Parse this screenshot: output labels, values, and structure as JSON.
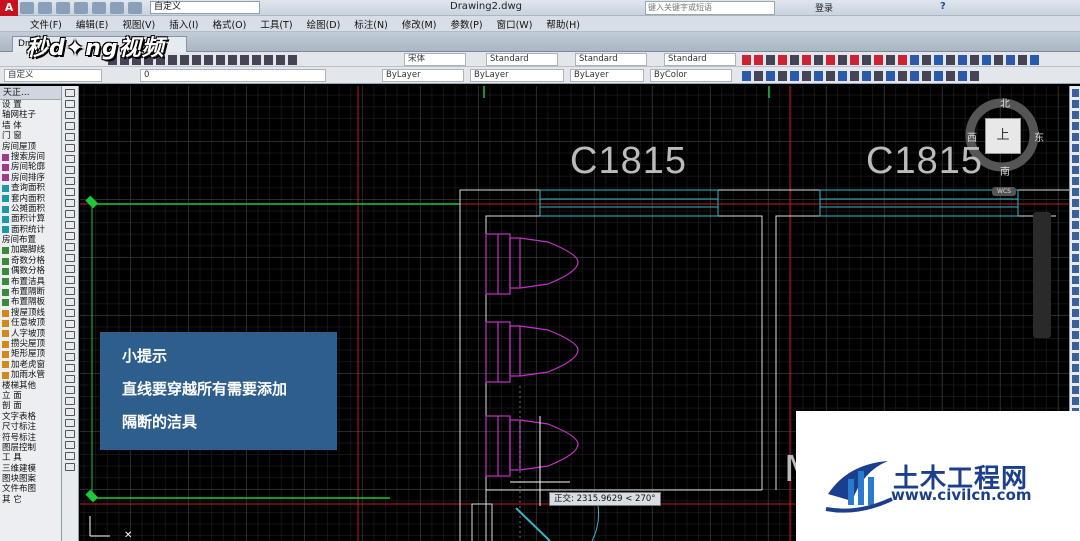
{
  "titlebar": {
    "app_logo": "A",
    "workspace": "自定义",
    "document_title": "Drawing2.dwg",
    "search_placeholder": "键入关键字或短语",
    "login_label": "登录",
    "help_label": "?"
  },
  "menubar": {
    "items": [
      "文件(F)",
      "编辑(E)",
      "视图(V)",
      "插入(I)",
      "格式(O)",
      "工具(T)",
      "绘图(D)",
      "标注(N)",
      "修改(M)",
      "参数(P)",
      "窗口(W)",
      "帮助(H)"
    ]
  },
  "tabbar": {
    "doc_tab_label": "Drawi"
  },
  "brand_logo": "秒d✦ng视频",
  "toolbar2": {
    "text_style": "宋体",
    "dim_style": "Standard",
    "table_style": "Standard",
    "multileader_style": "Standard"
  },
  "toolbar3": {
    "workspace_select": "自定义",
    "layer_select": "0",
    "color_select": "ByLayer",
    "linetype_select": "ByLayer",
    "lineweight_select": "ByLayer",
    "plotstyle_select": "ByColor"
  },
  "left_panel": {
    "header": "天正...",
    "items": [
      {
        "label": "设    置",
        "sw": ""
      },
      {
        "label": "轴网柱子",
        "sw": ""
      },
      {
        "label": "墙    体",
        "sw": ""
      },
      {
        "label": "门    窗",
        "sw": ""
      },
      {
        "label": "房间屋顶",
        "sw": ""
      },
      {
        "label": "搜索房间",
        "sw": "m"
      },
      {
        "label": "房间轮廓",
        "sw": "m"
      },
      {
        "label": "房间排序",
        "sw": "m"
      },
      {
        "label": "查询面积",
        "sw": "c"
      },
      {
        "label": "套内面积",
        "sw": "c"
      },
      {
        "label": "公摊面积",
        "sw": "c"
      },
      {
        "label": "面积计算",
        "sw": "c"
      },
      {
        "label": "面积统计",
        "sw": "c"
      },
      {
        "label": "房间布置",
        "sw": ""
      },
      {
        "label": "加踢脚线",
        "sw": "g"
      },
      {
        "label": "奇数分格",
        "sw": "g"
      },
      {
        "label": "偶数分格",
        "sw": "g"
      },
      {
        "label": "布置洁具",
        "sw": "g"
      },
      {
        "label": "布置隔断",
        "sw": "g"
      },
      {
        "label": "布置隔板",
        "sw": "g"
      },
      {
        "label": "搜屋顶线",
        "sw": "o"
      },
      {
        "label": "任意坡顶",
        "sw": "o"
      },
      {
        "label": "人字坡顶",
        "sw": "o"
      },
      {
        "label": "攒尖屋顶",
        "sw": "o"
      },
      {
        "label": "矩形屋顶",
        "sw": "o"
      },
      {
        "label": "加老虎窗",
        "sw": "o"
      },
      {
        "label": "加雨水管",
        "sw": "o"
      },
      {
        "label": "楼梯其他",
        "sw": ""
      },
      {
        "label": "立    面",
        "sw": ""
      },
      {
        "label": "剖    面",
        "sw": ""
      },
      {
        "label": "文字表格",
        "sw": ""
      },
      {
        "label": "尺寸标注",
        "sw": ""
      },
      {
        "label": "符号标注",
        "sw": ""
      },
      {
        "label": "图层控制",
        "sw": ""
      },
      {
        "label": "工    具",
        "sw": ""
      },
      {
        "label": "三维建模",
        "sw": ""
      },
      {
        "label": "图块图案",
        "sw": ""
      },
      {
        "label": "文件布图",
        "sw": ""
      },
      {
        "label": "其    它",
        "sw": ""
      }
    ]
  },
  "canvas": {
    "window_labels": [
      "C1815",
      "C1815"
    ],
    "partial_label": "M",
    "compass": {
      "north": "北",
      "south": "南",
      "east": "东",
      "west": "西",
      "face": "上"
    },
    "wcs_label": "WCS",
    "crosshair_tooltip": "正交: 2315.9629 < 270°"
  },
  "tip": {
    "title": "小提示",
    "line1": "直线要穿越所有需要添加",
    "line2": "隔断的洁具"
  },
  "watermark": {
    "name": "土木工程网",
    "url": "www.civilcn.com"
  }
}
